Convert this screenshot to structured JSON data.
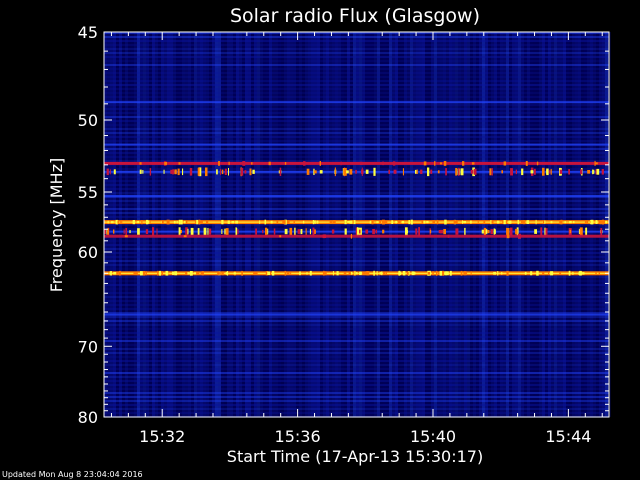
{
  "chart_data": {
    "type": "heatmap",
    "title": "Solar radio Flux (Glasgow)",
    "xlabel": "Start Time (17-Apr-13 15:30:17)",
    "ylabel": "Frequency [MHz]",
    "x_ticks": [
      "15:32",
      "15:36",
      "15:40",
      "15:44"
    ],
    "x_tick_minutes": [
      32,
      36,
      40,
      44
    ],
    "xlim_minutes": [
      30.28,
      45.2
    ],
    "y_ticks": [
      "45",
      "50",
      "55",
      "60",
      "70",
      "80"
    ],
    "y_tick_values": [
      45,
      50,
      55,
      60,
      70,
      80
    ],
    "ylim": [
      45,
      80
    ],
    "y_scale": "reciprocal",
    "grid": false,
    "colormap": [
      "#00004a",
      "#0a14a0",
      "#2244ff",
      "#c8143c",
      "#ff7a00",
      "#ffff40"
    ],
    "bands": [
      {
        "freq": 48.9,
        "level": "low"
      },
      {
        "freq": 51.6,
        "level": "low"
      },
      {
        "freq": 52.9,
        "level": "high"
      },
      {
        "freq": 53.5,
        "level": "bursty"
      },
      {
        "freq": 55.3,
        "level": "low"
      },
      {
        "freq": 57.4,
        "level": "very high"
      },
      {
        "freq": 58.2,
        "level": "bursty"
      },
      {
        "freq": 58.6,
        "level": "medium"
      },
      {
        "freq": 62.0,
        "level": "very high"
      },
      {
        "freq": 66.3,
        "level": "low"
      }
    ]
  },
  "footer": {
    "updated": "Updated Mon Aug  8 23:04:04 2016"
  }
}
